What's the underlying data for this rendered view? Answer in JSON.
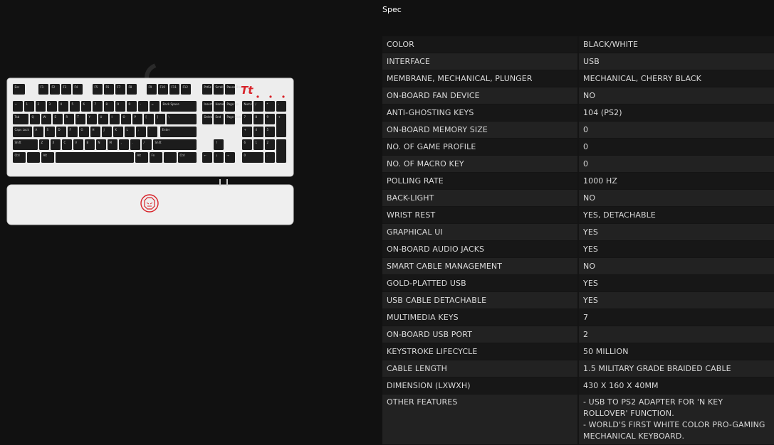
{
  "spec_title": "Spec",
  "product": {
    "brand_mark": "Tt",
    "key_labels": {
      "esc": "Esc",
      "f_keys": [
        "F1",
        "F2",
        "F3",
        "F4",
        "F5",
        "F6",
        "F7",
        "F8",
        "F9",
        "F10",
        "F11",
        "F12"
      ],
      "nav_top": [
        "PrtSc SysRq",
        "Scroll Lock",
        "Pause Break"
      ],
      "row1": [
        "~",
        "1",
        "2",
        "3",
        "4",
        "5",
        "6",
        "7",
        "8",
        "9",
        "0",
        "-",
        "=",
        "Back Space"
      ],
      "row2": [
        "Tab",
        "Q",
        "W",
        "E",
        "R",
        "T",
        "Y",
        "U",
        "I",
        "O",
        "P",
        "[",
        "]",
        "\\"
      ],
      "row3": [
        "Caps Lock",
        "A",
        "S",
        "D",
        "F",
        "G",
        "H",
        "J",
        "K",
        "L",
        ";",
        "'",
        "Enter"
      ],
      "row4": [
        "Shift",
        "Z",
        "X",
        "C",
        "V",
        "B",
        "N",
        "M",
        ",",
        ".",
        "/",
        "Shift"
      ],
      "row5": [
        "Ctrl",
        "Alt",
        "Fn",
        "Ctrl"
      ],
      "nav": [
        "Insert",
        "Home",
        "Page Up",
        "Delete",
        "End",
        "Page Down"
      ],
      "numpad": [
        "Num Lock",
        "/",
        "*",
        "-",
        "7",
        "8",
        "9",
        "+",
        "4",
        "5",
        "6",
        "1",
        "2",
        "3",
        "0",
        "."
      ]
    },
    "colors": {
      "body": "#eeeeee",
      "keys": "#1c1c1c",
      "brand": "#d8232a"
    }
  },
  "specs": [
    {
      "key": "COLOR",
      "value": "BLACK/WHITE"
    },
    {
      "key": "INTERFACE",
      "value": "USB"
    },
    {
      "key": "MEMBRANE, MECHANICAL, PLUNGER",
      "value": "MECHANICAL, CHERRY BLACK"
    },
    {
      "key": "ON-BOARD FAN DEVICE",
      "value": "NO"
    },
    {
      "key": "ANTI-GHOSTING KEYS",
      "value": "104 (PS2)"
    },
    {
      "key": "ON-BOARD MEMORY SIZE",
      "value": "0"
    },
    {
      "key": "NO. OF GAME PROFILE",
      "value": "0"
    },
    {
      "key": "NO. OF MACRO KEY",
      "value": "0"
    },
    {
      "key": "POLLING RATE",
      "value": "1000 HZ"
    },
    {
      "key": "BACK-LIGHT",
      "value": "NO"
    },
    {
      "key": "WRIST REST",
      "value": "YES, DETACHABLE"
    },
    {
      "key": "GRAPHICAL UI",
      "value": "YES"
    },
    {
      "key": "ON-BOARD AUDIO JACKS",
      "value": "YES"
    },
    {
      "key": "SMART CABLE MANAGEMENT",
      "value": "NO"
    },
    {
      "key": "GOLD-PLATTED USB",
      "value": "YES"
    },
    {
      "key": "USB CABLE DETACHABLE",
      "value": "YES"
    },
    {
      "key": "MULTIMEDIA KEYS",
      "value": "7"
    },
    {
      "key": "ON-BOARD USB PORT",
      "value": "2"
    },
    {
      "key": "KEYSTROKE LIFECYCLE",
      "value": "50 MILLION"
    },
    {
      "key": "CABLE LENGTH",
      "value": "1.5 MILITARY GRADE BRAIDED CABLE"
    },
    {
      "key": "DIMENSION (LXWXH)",
      "value": "430 X 160 X 40MM"
    },
    {
      "key": "OTHER FEATURES",
      "value": "- USB TO PS2 ADAPTER FOR 'N KEY ROLLOVER' FUNCTION.\n- WORLD'S FIRST WHITE COLOR PRO-GAMING MECHANICAL KEYBOARD."
    }
  ]
}
